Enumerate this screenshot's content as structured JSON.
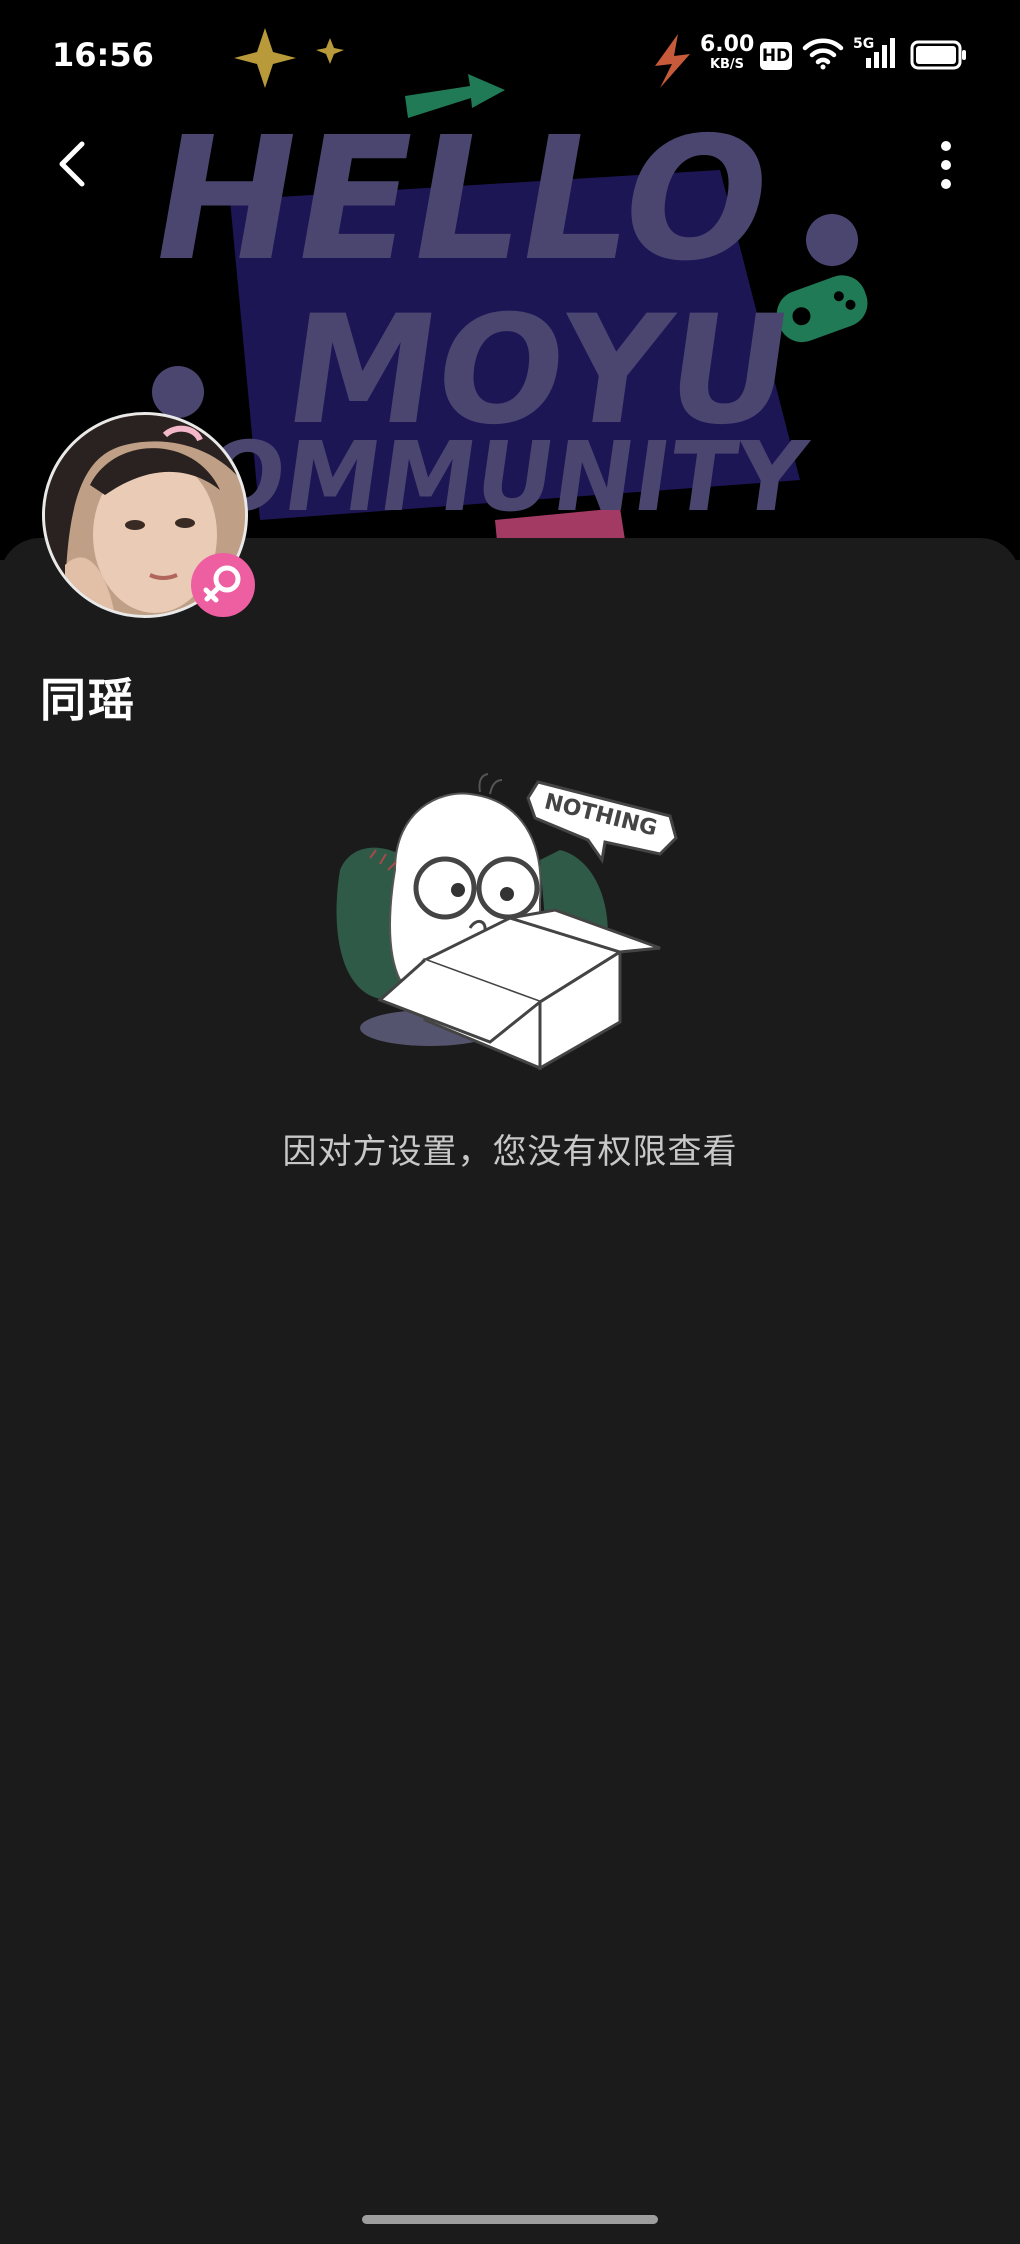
{
  "status_bar": {
    "time": "16:56",
    "network_speed": "6.00",
    "network_speed_unit": "KB/S",
    "hd_label": "HD",
    "cell_label": "5G"
  },
  "banner": {
    "line1": "HELLO",
    "line2": "MOYU",
    "line3": "COMMUNITY"
  },
  "profile": {
    "name": "同瑶",
    "gender_icon": "female-icon"
  },
  "empty_state": {
    "sign_text": "NOTHING",
    "message": "因对方设置，您没有权限查看"
  },
  "colors": {
    "background": "#1b1b1b",
    "banner_background": "#000000",
    "banner_text": "#4a4670",
    "female_badge": "#ee5fa1",
    "message_text": "#c8c8c8"
  }
}
